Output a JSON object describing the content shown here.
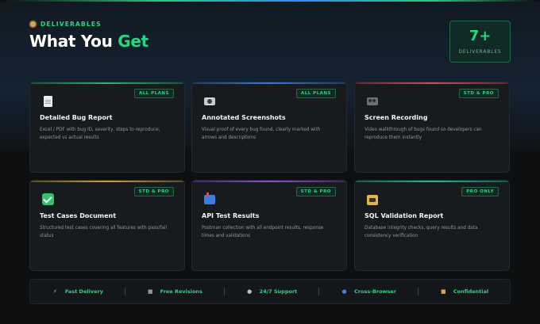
{
  "header": {
    "eyebrow": "DELIVERABLES",
    "title_main": "What You ",
    "title_accent": "Get",
    "count_value": "7+",
    "count_label": "DELIVERABLES"
  },
  "colors": {
    "accent": "#23d883",
    "background": "#0d0f10",
    "card": "#171b1e"
  },
  "cards": [
    {
      "icon": "document-icon",
      "badge": "ALL PLANS",
      "title": "Detailed Bug Report",
      "description": "Excel / PDF with bug ID, severity, steps to reproduce, expected vs actual results",
      "top_color": "#1fb96a"
    },
    {
      "icon": "camera-icon",
      "badge": "ALL PLANS",
      "title": "Annotated Screenshots",
      "description": "Visual proof of every bug found, clearly marked with arrows and descriptions",
      "top_color": "#2f7fd6"
    },
    {
      "icon": "film-camera-icon",
      "badge": "STD & PRO",
      "title": "Screen Recording",
      "description": "Video walkthrough of bugs found so developers can reproduce them instantly",
      "top_color": "#d6495a"
    },
    {
      "icon": "checkmark-icon",
      "badge": "STD & PRO",
      "title": "Test Cases Document",
      "description": "Structured test cases covering all features with pass/fail status",
      "top_color": "#c9a13a"
    },
    {
      "icon": "mailbox-icon",
      "badge": "STD & PRO",
      "title": "API Test Results",
      "description": "Postman collection with all endpoint results, response times and validations",
      "top_color": "#8a4fd6"
    },
    {
      "icon": "database-icon",
      "badge": "PRO ONLY",
      "title": "SQL Validation Report",
      "description": "Database integrity checks, query results and data consistency verification",
      "top_color": "#1fb9a8"
    }
  ],
  "features": [
    {
      "icon": "lightning-icon",
      "label": "Fast Delivery"
    },
    {
      "icon": "square-icon",
      "label": "Free Revisions"
    },
    {
      "icon": "chat-icon",
      "label": "24/7 Support"
    },
    {
      "icon": "globe-icon",
      "label": "Cross-Browser"
    },
    {
      "icon": "lock-icon",
      "label": "Confidential"
    }
  ]
}
